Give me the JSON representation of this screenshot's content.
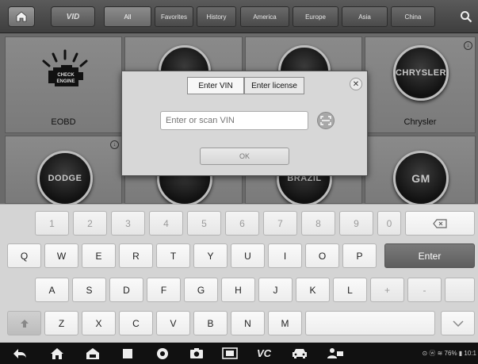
{
  "topbar": {
    "home_icon": "home-icon",
    "vid_label": "VID",
    "tabs": [
      "All",
      "Favorites",
      "History",
      "America",
      "Europe",
      "Asia",
      "China"
    ],
    "active_tab": "All",
    "search_icon": "search-icon"
  },
  "grid": {
    "tiles": [
      {
        "label": "EOBD",
        "emblem": "CHECK ENGINE",
        "icon": "check-engine-icon"
      },
      {
        "label": "",
        "emblem": ""
      },
      {
        "label": "",
        "emblem": ""
      },
      {
        "label": "Chrysler",
        "emblem": "CHRYSLER",
        "badge_icon": "download-icon"
      },
      {
        "label": "",
        "emblem": "DODGE",
        "badge_icon": "download-icon"
      },
      {
        "label": "",
        "emblem": ""
      },
      {
        "label": "",
        "emblem": "BRAZIL"
      },
      {
        "label": "",
        "emblem": "GM"
      }
    ]
  },
  "dialog": {
    "tabs": [
      "Enter VIN",
      "Enter license"
    ],
    "active_tab": "Enter VIN",
    "vin_placeholder": "Enter or scan VIN",
    "ok_label": "OK",
    "close_icon": "close-icon",
    "scan_icon": "barcode-scan-icon"
  },
  "keyboard": {
    "row1": [
      "1",
      "2",
      "3",
      "4",
      "5",
      "6",
      "7",
      "8",
      "9",
      "0"
    ],
    "row2": [
      "Q",
      "W",
      "E",
      "R",
      "T",
      "Y",
      "U",
      "I",
      "O",
      "P"
    ],
    "row3": [
      "A",
      "S",
      "D",
      "F",
      "G",
      "H",
      "J",
      "K",
      "L",
      "+",
      "-"
    ],
    "row4": [
      "Z",
      "X",
      "C",
      "V",
      "B",
      "N",
      "M"
    ],
    "enter_label": "Enter",
    "backspace_icon": "backspace-icon",
    "shift_icon": "shift-icon",
    "hide_icon": "hide-keyboard-icon"
  },
  "navbar": {
    "icons": [
      "back-icon",
      "home-icon",
      "autel-home-icon",
      "recent-apps-icon",
      "chrome-icon",
      "camera-icon",
      "screenshot-icon",
      "vci-icon",
      "vehicle-icon",
      "remote-expert-icon"
    ],
    "vci_label": "VC",
    "status_text": "76%",
    "time": "10:1"
  }
}
